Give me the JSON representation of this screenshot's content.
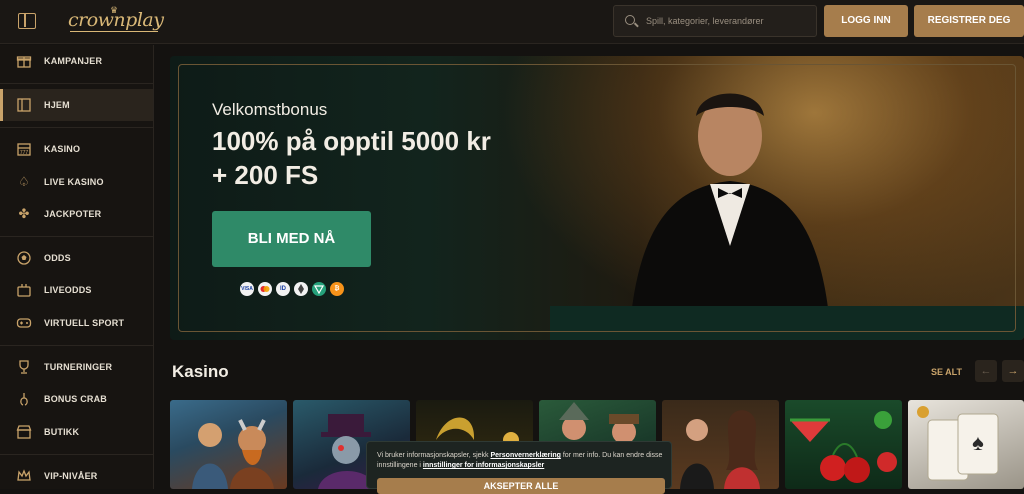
{
  "header": {
    "logo_text": "crownplay",
    "search_placeholder": "Spill, kategorier, leverandører",
    "login_label": "LOGG INN",
    "register_label": "REGISTRER DEG"
  },
  "sidebar": {
    "items": [
      {
        "label": "KAMPANJER",
        "icon": "gift-icon"
      },
      {
        "label": "HJEM",
        "icon": "home-icon",
        "active": true
      },
      {
        "label": "KASINO",
        "icon": "slot-machine-icon"
      },
      {
        "label": "LIVE KASINO",
        "icon": "spade-icon"
      },
      {
        "label": "JACKPOTER",
        "icon": "clover-icon"
      },
      {
        "label": "ODDS",
        "icon": "football-icon"
      },
      {
        "label": "LIVEODDS",
        "icon": "live-odds-icon"
      },
      {
        "label": "VIRTUELL SPORT",
        "icon": "gamepad-icon"
      },
      {
        "label": "TURNERINGER",
        "icon": "trophy-icon"
      },
      {
        "label": "BONUS CRAB",
        "icon": "claw-icon"
      },
      {
        "label": "BUTIKK",
        "icon": "shop-icon"
      },
      {
        "label": "VIP-NIVÅER",
        "icon": "crown-icon"
      }
    ]
  },
  "hero": {
    "subtitle": "Velkomstbonus",
    "title_line1": "100% på opptil 5000 kr",
    "title_line2": "+ 200 FS",
    "cta_label": "BLI MED NÅ",
    "payment_icons": [
      "VISA",
      "MC",
      "ID",
      "ETH",
      "USDT",
      "BTC"
    ]
  },
  "casino_section": {
    "title": "Kasino",
    "see_all_label": "SE ALT"
  },
  "cookie_banner": {
    "text_before_link1": "Vi bruker informasjonskapsler, sjekk ",
    "link1": "Personvernerklæring",
    "text_middle": " for mer info. Du kan endre disse innstillingene i ",
    "link2": "innstillinger for informasjonskapsler",
    "accept_label": "AKSEPTER ALLE"
  },
  "colors": {
    "accent_gold": "#c9a36a",
    "button_gold": "#a67d4c",
    "cta_green": "#2f8a68",
    "background": "#141210"
  }
}
